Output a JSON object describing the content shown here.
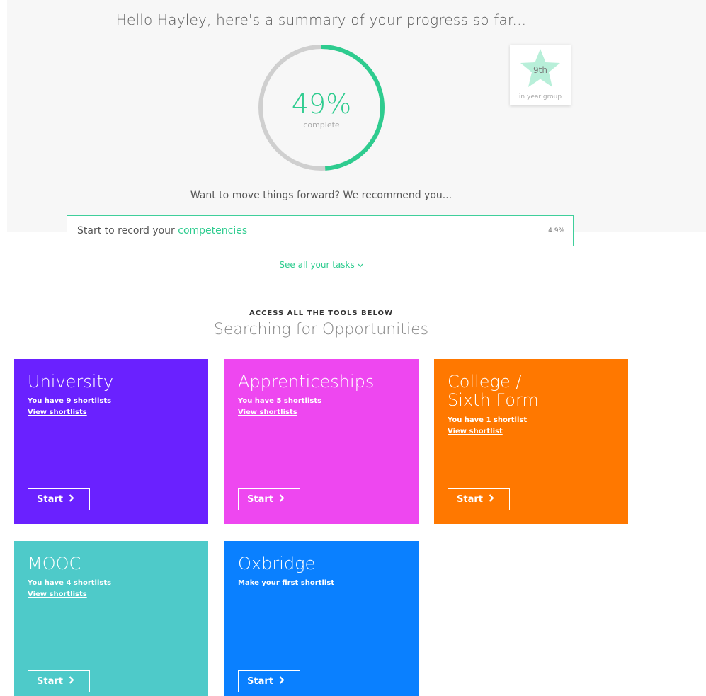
{
  "summary": {
    "greeting": "Hello Hayley, here's a summary of your progress so far...",
    "progress_percent": 49,
    "progress_label": "49%",
    "progress_caption": "complete",
    "rank": {
      "position": "9th",
      "caption": "in year group"
    },
    "recommend_text": "Want to move things forward? We recommend you...",
    "task": {
      "prefix": "Start to record your ",
      "link": "competencies",
      "percent": "4.9%"
    },
    "see_all_tasks": "See all your tasks",
    "see_all_icon": "chevron-down-icon"
  },
  "tools": {
    "eyebrow": "ACCESS ALL THE TOOLS BELOW",
    "title": "Searching for Opportunities",
    "tiles": [
      {
        "title": "University",
        "subtitle": "You have 9 shortlists",
        "link": "View shortlists",
        "button": "Start",
        "color": "#6a21ff"
      },
      {
        "title": "Apprenticeships",
        "subtitle": "You have 5 shortlists",
        "link": "View shortlists",
        "button": "Start",
        "color": "#ee47f0"
      },
      {
        "title": "College / Sixth Form",
        "title_line1": "College /",
        "title_line2": "Sixth Form",
        "subtitle": "You have 1 shortlist",
        "link": "View shortlist",
        "button": "Start",
        "color": "#ff7800"
      },
      {
        "title": "MOOC",
        "subtitle": "You have 4 shortlists",
        "link": "View shortlists",
        "button": "Start",
        "color": "#4ecac9"
      },
      {
        "title": "Oxbridge",
        "subtitle": "Make your first shortlist",
        "button": "Start",
        "color": "#0a80ff"
      }
    ]
  },
  "colors": {
    "accent": "#2ecc8f",
    "ring_track": "#cfcfcf",
    "star": "#b8efd9"
  }
}
